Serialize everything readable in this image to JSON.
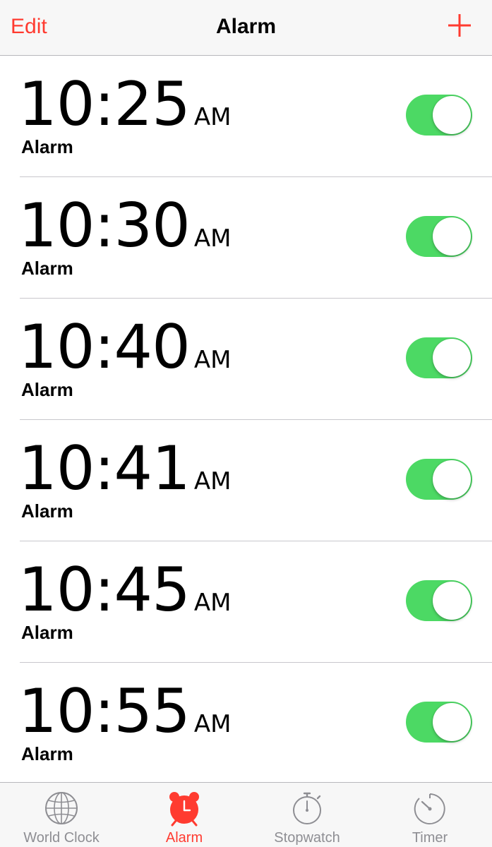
{
  "navbar": {
    "edit_label": "Edit",
    "title": "Alarm",
    "add_icon": "plus-icon"
  },
  "colors": {
    "accent": "#ff3b30",
    "toggle_on": "#4cd964",
    "inactive_tab": "#8e8e93"
  },
  "alarms": [
    {
      "time": "10:25",
      "ampm": "AM",
      "label": "Alarm",
      "enabled": true
    },
    {
      "time": "10:30",
      "ampm": "AM",
      "label": "Alarm",
      "enabled": true
    },
    {
      "time": "10:40",
      "ampm": "AM",
      "label": "Alarm",
      "enabled": true
    },
    {
      "time": "10:41",
      "ampm": "AM",
      "label": "Alarm",
      "enabled": true
    },
    {
      "time": "10:45",
      "ampm": "AM",
      "label": "Alarm",
      "enabled": true
    },
    {
      "time": "10:55",
      "ampm": "AM",
      "label": "Alarm",
      "enabled": true
    }
  ],
  "tabbar": {
    "tabs": [
      {
        "label": "World Clock",
        "icon": "globe-icon",
        "active": false
      },
      {
        "label": "Alarm",
        "icon": "alarm-clock-icon",
        "active": true
      },
      {
        "label": "Stopwatch",
        "icon": "stopwatch-icon",
        "active": false
      },
      {
        "label": "Timer",
        "icon": "timer-icon",
        "active": false
      }
    ]
  }
}
